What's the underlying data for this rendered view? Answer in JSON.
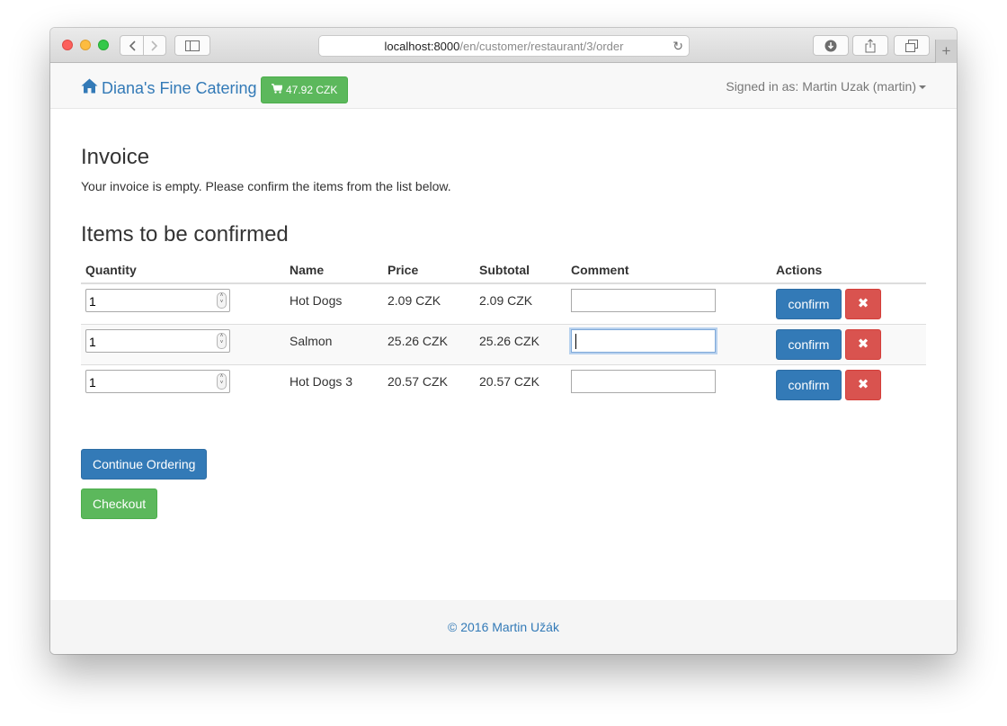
{
  "browser": {
    "url_host": "localhost:8000",
    "url_path": "/en/customer/restaurant/3/order",
    "icons": [
      "back-icon",
      "forward-icon",
      "sidebar-icon",
      "reload-icon",
      "download-icon",
      "share-icon",
      "tabs-icon",
      "new-tab-icon"
    ]
  },
  "navbar": {
    "brand": "Diana's Fine Catering",
    "brand_icon": "home-icon",
    "cart_total": "47.92 CZK",
    "cart_icon": "shopping-cart-icon",
    "signed_in": "Signed in as: Martin Uzak (martin)"
  },
  "invoice": {
    "title": "Invoice",
    "empty_message": "Your invoice is empty. Please confirm the items from the list below."
  },
  "items_section": {
    "title": "Items to be confirmed",
    "columns": [
      "Quantity",
      "Name",
      "Price",
      "Subtotal",
      "Comment",
      "Actions"
    ],
    "rows": [
      {
        "quantity": "1",
        "name": "Hot Dogs",
        "price": "2.09 CZK",
        "subtotal": "2.09 CZK",
        "comment": ""
      },
      {
        "quantity": "1",
        "name": "Salmon",
        "price": "25.26 CZK",
        "subtotal": "25.26 CZK",
        "comment": ""
      },
      {
        "quantity": "1",
        "name": "Hot Dogs 3",
        "price": "20.57 CZK",
        "subtotal": "20.57 CZK",
        "comment": ""
      }
    ],
    "confirm_label": "confirm",
    "remove_symbol": "✖"
  },
  "buttons": {
    "continue": "Continue Ordering",
    "checkout": "Checkout"
  },
  "footer": {
    "text": "© 2016 Martin Užák"
  },
  "colors": {
    "primary": "#337ab7",
    "success": "#5cb85c",
    "danger": "#d9534f"
  }
}
